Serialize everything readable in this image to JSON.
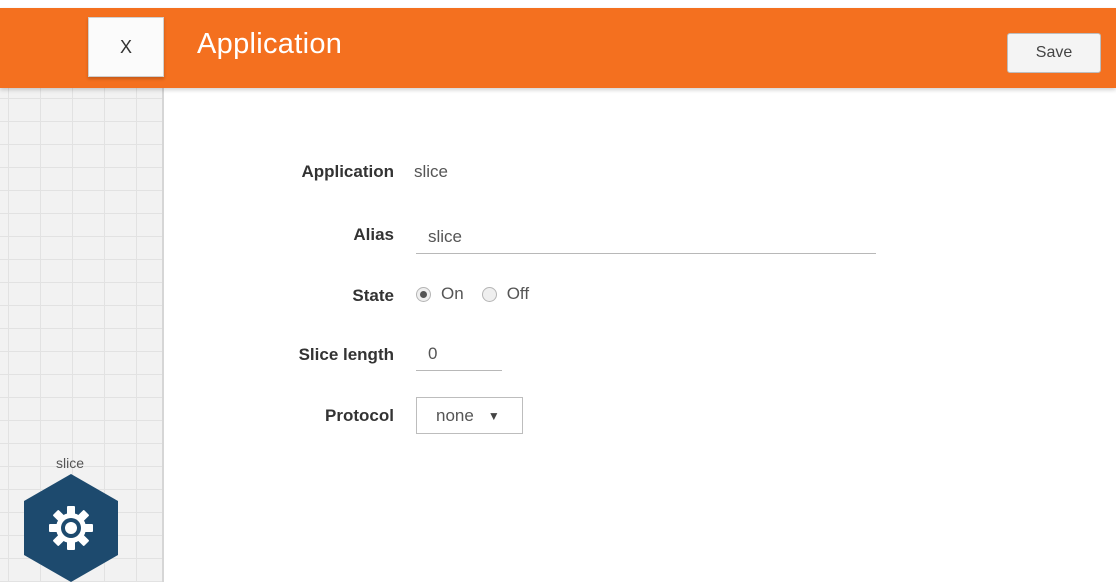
{
  "header": {
    "close_label": "X",
    "title": "Application",
    "save_label": "Save",
    "accent_color": "#f4701f"
  },
  "canvas": {
    "node_label": "slice",
    "node_icon": "gear-icon",
    "node_color": "#1d4a6e"
  },
  "form": {
    "application": {
      "label": "Application",
      "value": "slice"
    },
    "alias": {
      "label": "Alias",
      "value": "slice"
    },
    "state": {
      "label": "State",
      "options": [
        {
          "label": "On",
          "selected": true
        },
        {
          "label": "Off",
          "selected": false
        }
      ]
    },
    "slice_length": {
      "label": "Slice length",
      "value": "0"
    },
    "protocol": {
      "label": "Protocol",
      "selected": "none",
      "caret": "▼"
    }
  }
}
